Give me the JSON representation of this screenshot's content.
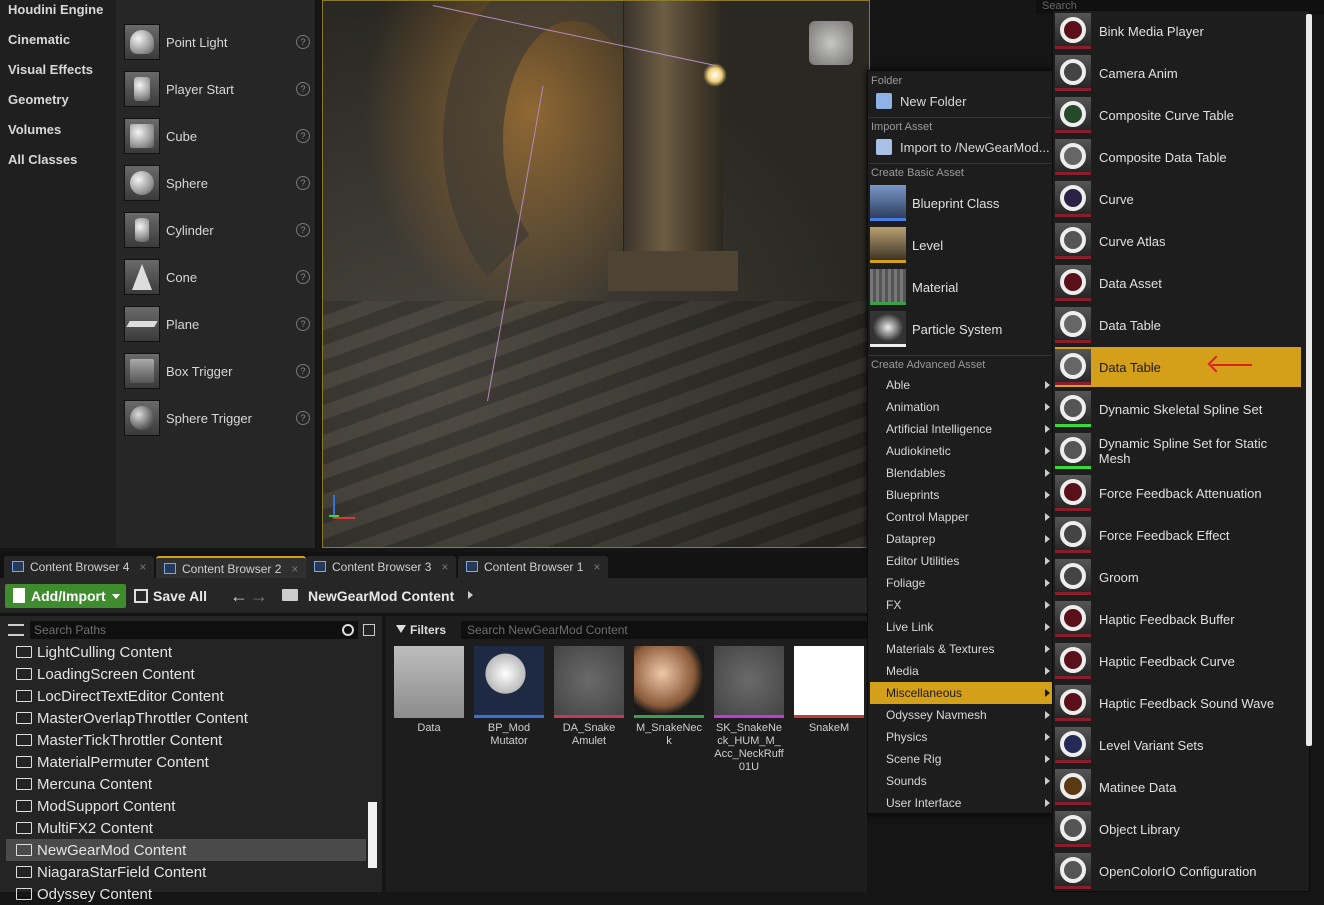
{
  "categories": [
    "Houdini Engine",
    "Cinematic",
    "Visual Effects",
    "Geometry",
    "Volumes",
    "All Classes"
  ],
  "actors": [
    {
      "label": "Point Light",
      "icon": "point-light-icon"
    },
    {
      "label": "Player Start",
      "icon": "player-start-icon"
    },
    {
      "label": "Cube",
      "icon": "cube-icon"
    },
    {
      "label": "Sphere",
      "icon": "sphere-icon"
    },
    {
      "label": "Cylinder",
      "icon": "cylinder-icon"
    },
    {
      "label": "Cone",
      "icon": "cone-icon"
    },
    {
      "label": "Plane",
      "icon": "plane-icon"
    },
    {
      "label": "Box Trigger",
      "icon": "box-trigger-icon"
    },
    {
      "label": "Sphere Trigger",
      "icon": "sphere-trigger-icon"
    }
  ],
  "help_glyph": "?",
  "menu": {
    "folder_header": "Folder",
    "new_folder": "New Folder",
    "import_header": "Import Asset",
    "import_to": "Import to /NewGearMod...",
    "basic_header": "Create Basic Asset",
    "basic": [
      "Blueprint Class",
      "Level",
      "Material",
      "Particle System"
    ],
    "advanced_header": "Create Advanced Asset",
    "advanced": [
      "Able",
      "Animation",
      "Artificial Intelligence",
      "Audiokinetic",
      "Blendables",
      "Blueprints",
      "Control Mapper",
      "Dataprep",
      "Editor Utilities",
      "Foliage",
      "FX",
      "Live Link",
      "Materials & Textures",
      "Media",
      "Miscellaneous",
      "Odyssey Navmesh",
      "Physics",
      "Scene Rig",
      "Sounds",
      "User Interface"
    ],
    "advanced_selected": "Miscellaneous"
  },
  "submenu": {
    "search_placeholder": "Search",
    "items": [
      "Bink Media Player",
      "Camera Anim",
      "Composite Curve Table",
      "Composite Data Table",
      "Curve",
      "Curve Atlas",
      "Data Asset",
      "Data Table",
      "Data Table",
      "Dynamic Skeletal Spline Set",
      "Dynamic Spline Set for Static Mesh",
      "Force Feedback Attenuation",
      "Force Feedback Effect",
      "Groom",
      "Haptic Feedback Buffer",
      "Haptic Feedback Curve",
      "Haptic Feedback Sound Wave",
      "Level Variant Sets",
      "Matinee Data",
      "Object Library",
      "OpenColorIO Configuration"
    ],
    "selected_index": 8
  },
  "tabs": [
    {
      "label": "Content Browser 4",
      "active": false
    },
    {
      "label": "Content Browser 2",
      "active": true
    },
    {
      "label": "Content Browser 3",
      "active": false
    },
    {
      "label": "Content Browser 1",
      "active": false
    }
  ],
  "tab_close": "×",
  "toolbar": {
    "add_import": "Add/Import",
    "save_all": "Save All",
    "back": "←",
    "forward": "→",
    "breadcrumb": "NewGearMod Content"
  },
  "paths": {
    "search_placeholder": "Search Paths",
    "folders": [
      "LightCulling Content",
      "LoadingScreen Content",
      "LocDirectTextEditor Content",
      "MasterOverlapThrottler Content",
      "MasterTickThrottler Content",
      "MaterialPermuter Content",
      "Mercuna Content",
      "ModSupport Content",
      "MultiFX2 Content",
      "NewGearMod Content",
      "NiagaraStarField Content",
      "Odyssey Content"
    ],
    "selected": "NewGearMod Content"
  },
  "assets": {
    "filters_label": "Filters",
    "search_placeholder": "Search NewGearMod Content",
    "items": [
      {
        "label": "Data",
        "color": "#d8d8d8"
      },
      {
        "label": "BP_Mod Mutator",
        "color": "#3a6fd8"
      },
      {
        "label": "DA_Snake Amulet",
        "color": "#c23a5a"
      },
      {
        "label": "M_SnakeNeck",
        "color": "#3aa04a"
      },
      {
        "label": "SK_SnakeNeck_HUM_M_Acc_NeckRuff01U",
        "color": "#c23ad8"
      },
      {
        "label": "SnakeM",
        "color": "#c23a3a"
      }
    ]
  },
  "colors": {
    "accent": "#d49f19",
    "add_button": "#3e8c2e"
  }
}
